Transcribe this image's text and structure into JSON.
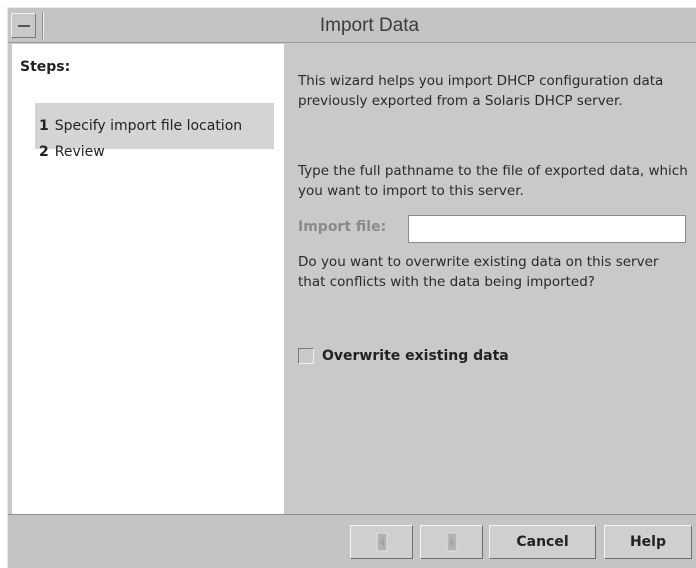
{
  "window": {
    "title": "Import Data"
  },
  "steps": {
    "header": "Steps:",
    "items": [
      {
        "number": "1",
        "label": "Specify import file location",
        "selected": true
      },
      {
        "number": "2",
        "label": "Review",
        "selected": false
      }
    ]
  },
  "content": {
    "intro": "This wizard helps you import DHCP configuration data previously exported from a Solaris DHCP server.",
    "instructions": "Type the full pathname to the file of exported data, which you want to import to this server.",
    "import_file": {
      "label": "Import file:",
      "value": ""
    },
    "overwrite_question": "Do you want to overwrite existing data on this server that conflicts with the data being imported?",
    "overwrite_checkbox": {
      "label": "Overwrite existing data",
      "checked": false
    }
  },
  "buttons": {
    "back_icon": "back-arrow-icon",
    "next_icon": "next-arrow-icon",
    "cancel": "Cancel",
    "help": "Help"
  },
  "colors": {
    "window_bg": "#c9c9c9",
    "steps_bg": "#ffffff",
    "selected_step_bg": "#d4d4d4",
    "disabled_text": "#8a8a8a"
  }
}
